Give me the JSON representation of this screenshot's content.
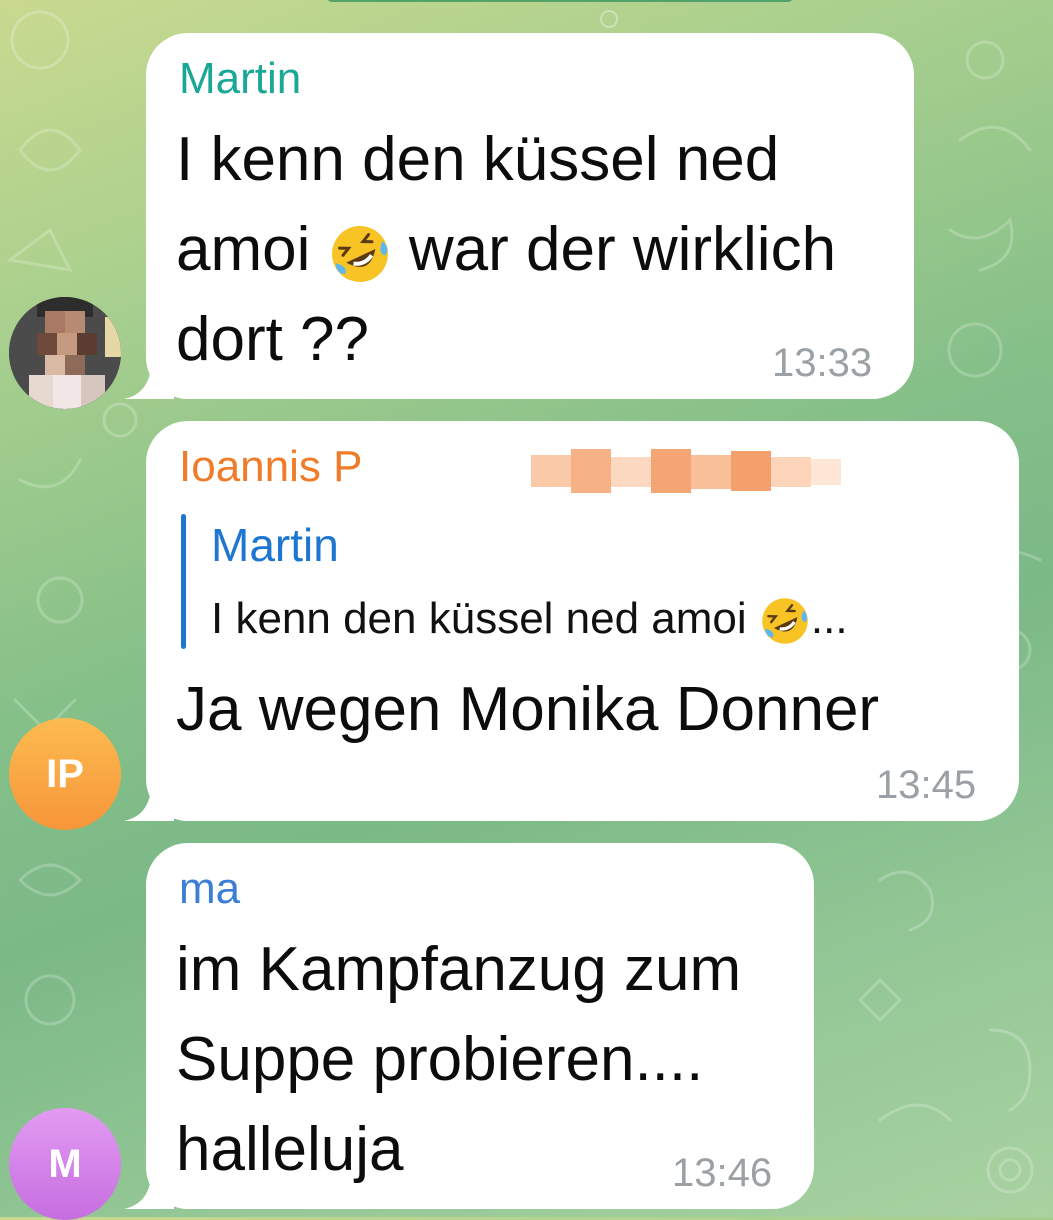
{
  "colors": {
    "martin_name": "#1aa796",
    "ioannis_name": "#ef7c2a",
    "ma_name": "#3b7ed6",
    "reply_accent": "#1d76d2",
    "timestamp": "#9aa0a4",
    "avatar_ip": "#f8a43a",
    "avatar_m": "#d47ae8"
  },
  "messages": [
    {
      "sender": "Martin",
      "lines": [
        "I kenn den küssel ned",
        "war der wirklich",
        "dort ??"
      ],
      "line2_prefix": "amoi",
      "emoji": "rolling-on-the-floor-laughing",
      "time": "13:33"
    },
    {
      "sender": "Ioannis P",
      "reply": {
        "name": "Martin",
        "text": "I kenn den küssel ned amoi",
        "ellipsis": "..."
      },
      "text": "Ja wegen Monika Donner",
      "time": "13:45",
      "avatar_initials": "IP"
    },
    {
      "sender": "ma",
      "lines": [
        "im Kampfanzug zum",
        "Suppe probieren....",
        "halleluja"
      ],
      "time": "13:46",
      "avatar_initials": "M"
    }
  ]
}
